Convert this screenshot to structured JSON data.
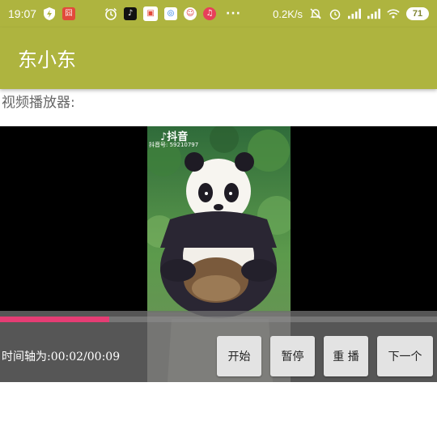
{
  "status_bar": {
    "time": "19:07",
    "speed": "0.2K/s",
    "battery": "71",
    "dots": "···"
  },
  "app_bar": {
    "title": "东小东",
    "color": "#aeb43f"
  },
  "player": {
    "label": "视频播放器:",
    "watermark_logo": "♪抖音",
    "watermark_id": "抖音号: 59210797",
    "progress": 0.25,
    "progress_color": "#e53d74",
    "timeline": "时间轴为:00:02/00:09"
  },
  "buttons": {
    "start": "开始",
    "pause": "暂停",
    "replay": "重 播",
    "next": "下一个"
  }
}
